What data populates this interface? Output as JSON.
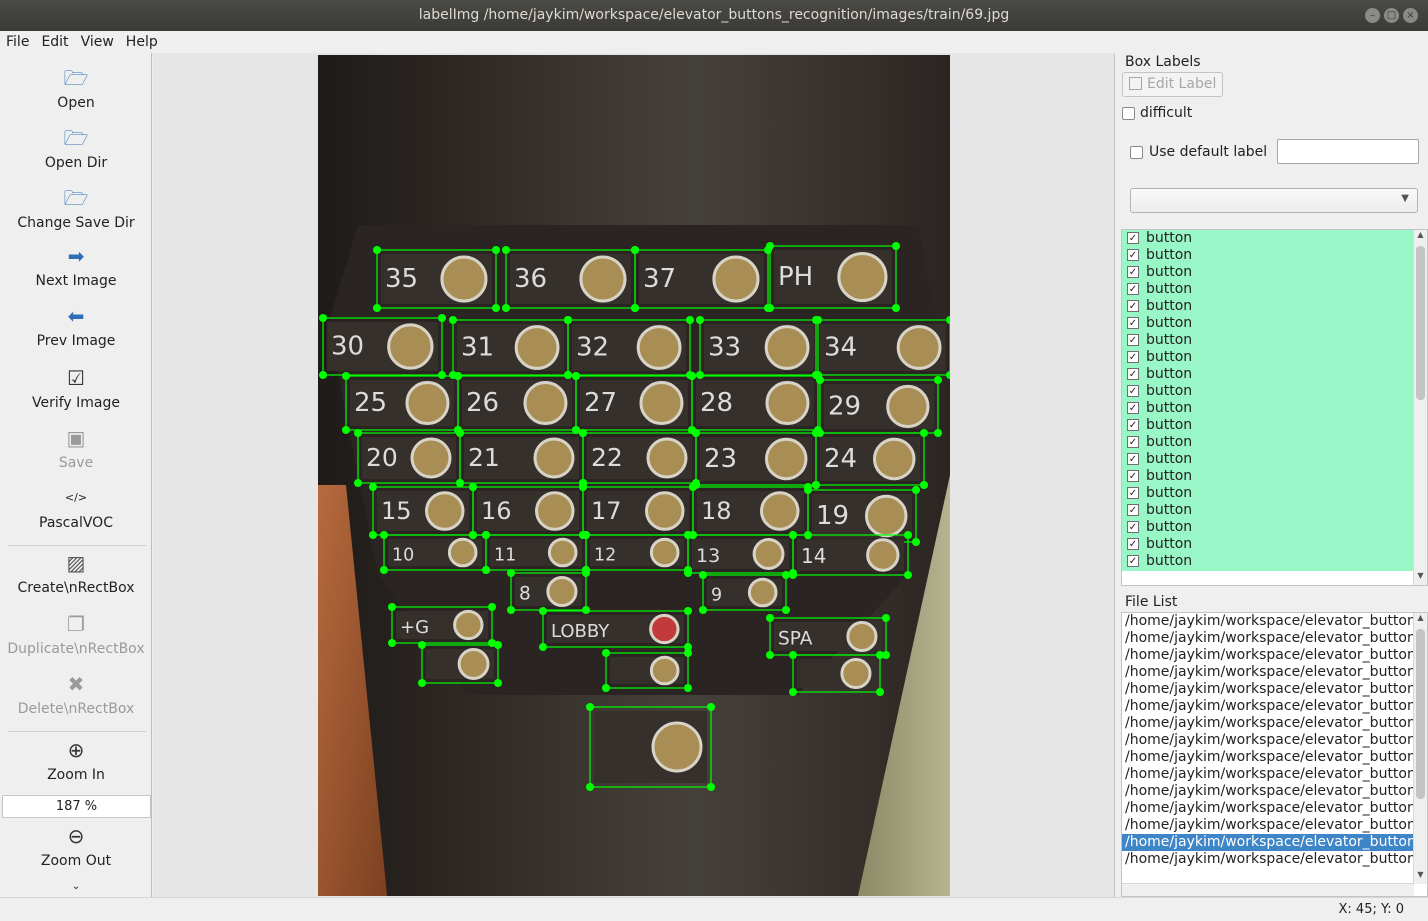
{
  "window": {
    "title": "labelImg /home/jaykim/workspace/elevator_buttons_recognition/images/train/69.jpg"
  },
  "menu": [
    "File",
    "Edit",
    "View",
    "Help"
  ],
  "tools": {
    "open": "Open",
    "open_dir": "Open Dir",
    "change_save_dir": "Change Save Dir",
    "next_image": "Next Image",
    "prev_image": "Prev Image",
    "verify_image": "Verify Image",
    "save": "Save",
    "format": "PascalVOC",
    "create_box": "Create\\nRectBox",
    "duplicate_box": "Duplicate\\nRectBox",
    "delete_box": "Delete\\nRectBox",
    "zoom_in": "Zoom In",
    "zoom_level": "187 %",
    "zoom_out": "Zoom Out"
  },
  "icons": {
    "open": "folder-icon",
    "open_dir": "folder-icon",
    "change_save_dir": "folder-icon",
    "next_image": "arrow-right-icon",
    "prev_image": "arrow-left-icon",
    "verify_image": "checkbox-icon",
    "save": "floppy-icon",
    "format": "code-icon",
    "create_box": "create-box-icon",
    "duplicate_box": "duplicate-icon",
    "delete_box": "delete-x-icon",
    "zoom_in": "zoom-in-icon",
    "zoom_out": "zoom-out-icon",
    "more": "chevron-down-icon"
  },
  "panel": {
    "box_labels_title": "Box Labels",
    "edit_label": "Edit Label",
    "difficult": "difficult",
    "use_default_label": "Use default label",
    "default_label_value": "",
    "combo_value": "",
    "labels": [
      "button",
      "button",
      "button",
      "button",
      "button",
      "button",
      "button",
      "button",
      "button",
      "button",
      "button",
      "button",
      "button",
      "button",
      "button",
      "button",
      "button",
      "button",
      "button",
      "button"
    ],
    "file_list_title": "File List",
    "files": [
      "/home/jaykim/workspace/elevator_button",
      "/home/jaykim/workspace/elevator_button",
      "/home/jaykim/workspace/elevator_button",
      "/home/jaykim/workspace/elevator_button",
      "/home/jaykim/workspace/elevator_button",
      "/home/jaykim/workspace/elevator_button",
      "/home/jaykim/workspace/elevator_button",
      "/home/jaykim/workspace/elevator_button",
      "/home/jaykim/workspace/elevator_button",
      "/home/jaykim/workspace/elevator_button",
      "/home/jaykim/workspace/elevator_button",
      "/home/jaykim/workspace/elevator_button",
      "/home/jaykim/workspace/elevator_button",
      "/home/jaykim/workspace/elevator_button",
      "/home/jaykim/workspace/elevator_button"
    ],
    "selected_file_index": 13
  },
  "image_labels": [
    "35",
    "36",
    "37",
    "PH",
    "30",
    "31",
    "32",
    "33",
    "34",
    "25",
    "26",
    "27",
    "28",
    "29",
    "20",
    "21",
    "22",
    "23",
    "24",
    "15",
    "16",
    "17",
    "18",
    "19",
    "10",
    "11",
    "12",
    "13",
    "14",
    "8",
    "9",
    "+G",
    "LOBBY",
    "SPA"
  ],
  "colors": {
    "box": "#00ff00",
    "label_bg": "#99f6c6",
    "selected": "#3f86c8"
  },
  "status": {
    "coords": "X: 45; Y: 0"
  }
}
